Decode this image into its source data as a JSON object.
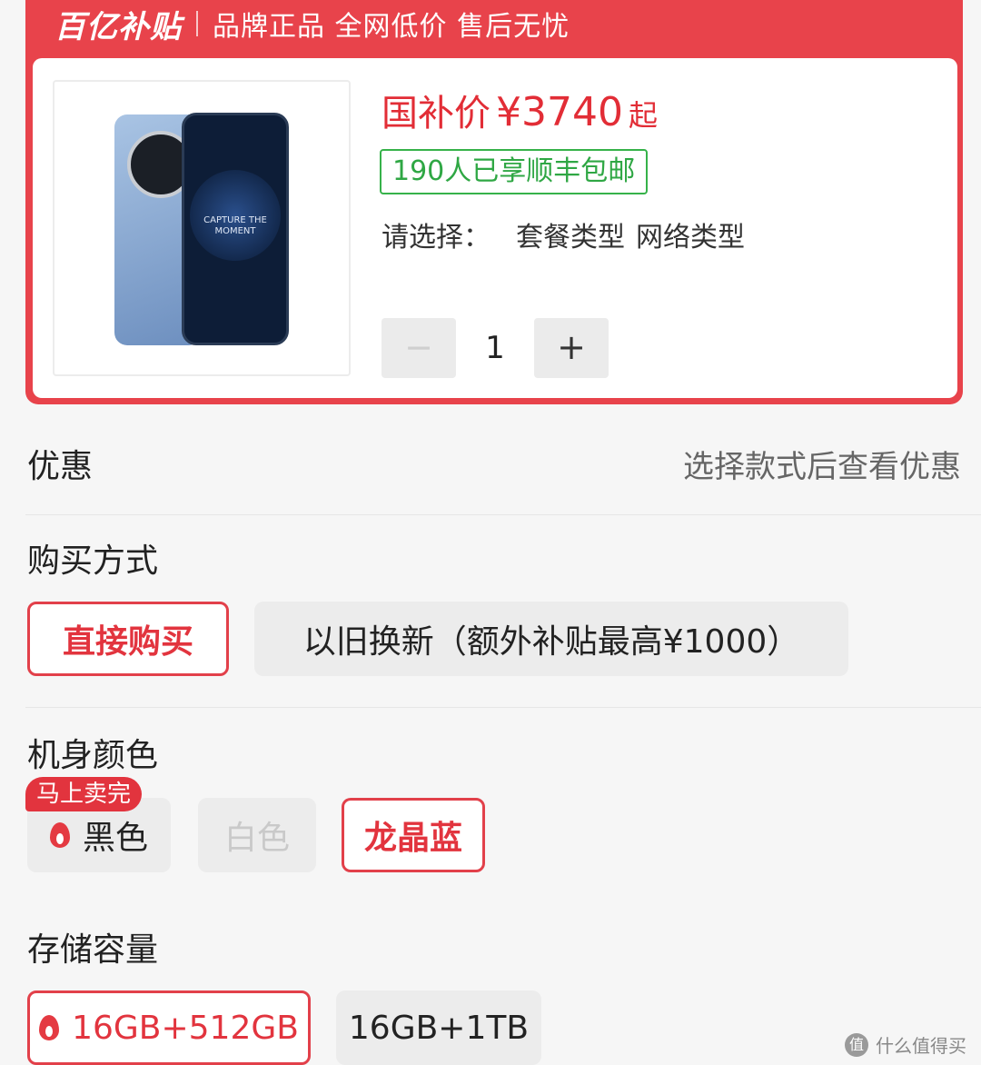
{
  "banner": {
    "logo": "百亿补贴",
    "slogan": "品牌正品 全网低价 售后无忧"
  },
  "product": {
    "screen_text": "CAPTURE THE MOMENT",
    "price_label": "国补价",
    "price_value": "¥3740",
    "price_suffix": "起",
    "shipping_badge": "190人已享顺丰包邮",
    "select_label": "请选择：",
    "select_options": [
      "套餐类型",
      "网络类型"
    ],
    "quantity": "1",
    "qty_minus": "−",
    "qty_plus": "+"
  },
  "discount": {
    "label": "优惠",
    "hint": "选择款式后查看优惠"
  },
  "purchase": {
    "label": "购买方式",
    "options": [
      "直接购买",
      "以旧换新（额外补贴最高¥1000）"
    ],
    "selected_index": 0
  },
  "color": {
    "label": "机身颜色",
    "hot_tag": "马上卖完",
    "options": [
      "黑色",
      "白色",
      "龙晶蓝"
    ],
    "selected_index": 2
  },
  "storage": {
    "label": "存储容量",
    "options": [
      "16GB+512GB",
      "16GB+1TB"
    ],
    "selected_index": 0
  },
  "watermark": {
    "icon_text": "值",
    "text": "什么值得买"
  },
  "colors": {
    "accent_red": "#e2343e",
    "banner_red": "#e8434b",
    "green": "#2fa744"
  }
}
